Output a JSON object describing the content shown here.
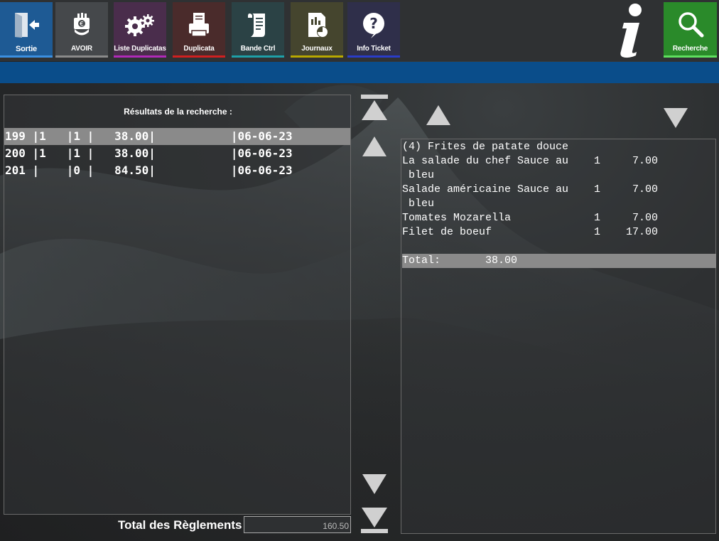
{
  "toolbar": {
    "buttons": [
      {
        "label": "Sortie",
        "icon": "exit-door-icon",
        "bg": "#1e5a94",
        "accent": "#3b8fe0"
      },
      {
        "label": "AVOIR",
        "icon": "credit-note-icon",
        "bg": "#45484b",
        "accent": "#8a8a8a"
      },
      {
        "label": "Liste Duplicatas",
        "icon": "gears-icon",
        "bg": "#4a2d4c",
        "accent": "#b02ab8"
      },
      {
        "label": "Duplicata",
        "icon": "printer-icon",
        "bg": "#4a2b2b",
        "accent": "#d02020"
      },
      {
        "label": "Bande Ctrl",
        "icon": "receipt-scroll-icon",
        "bg": "#2b4245",
        "accent": "#1ea0a8"
      },
      {
        "label": "Journaux",
        "icon": "report-chart-icon",
        "bg": "#45452e",
        "accent": "#b8a800"
      },
      {
        "label": "Info Ticket",
        "icon": "question-icon",
        "bg": "#2f2f4a",
        "accent": "#2a3cc8"
      }
    ],
    "info_icon": "info-icon",
    "search": {
      "label": "Recherche",
      "icon": "search-icon",
      "bg": "#2a8a2a",
      "accent": "#5fe05f"
    }
  },
  "results": {
    "title": "Résultats de la recherche :",
    "rows": [
      {
        "text": "199 |1   |1 |   38.00|           |06-06-23",
        "selected": true
      },
      {
        "text": "200 |1   |1 |   38.00|           |06-06-23",
        "selected": false
      },
      {
        "text": "201 |    |0 |   84.50|           |06-06-23",
        "selected": false
      }
    ]
  },
  "totals": {
    "label": "Total des Règlements :",
    "value": "160.50"
  },
  "ticket": {
    "lines": [
      "(4) Frites de patate douce",
      "La salade du chef Sauce au    1     7.00",
      " bleu",
      "Salade américaine Sauce au    1     7.00",
      " bleu",
      "Tomates Mozarella             1     7.00",
      "Filet de boeuf                1    17.00"
    ],
    "total_line": "Total:       38.00"
  }
}
